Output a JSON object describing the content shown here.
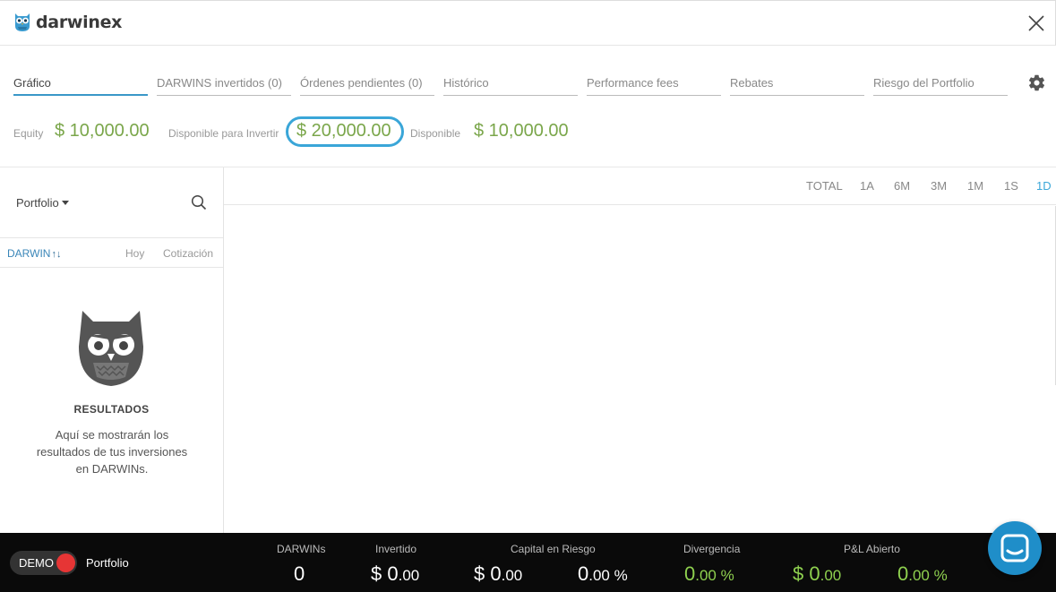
{
  "header": {
    "brand": "darwinex"
  },
  "tabs": [
    {
      "label": "Gráfico",
      "active": true
    },
    {
      "label": "DARWINS invertidos (0)"
    },
    {
      "label": "Órdenes pendientes (0)"
    },
    {
      "label": "Histórico"
    },
    {
      "label": "Performance fees"
    },
    {
      "label": "Rebates"
    },
    {
      "label": "Riesgo del Portfolio"
    }
  ],
  "balances": {
    "equity_label": "Equity",
    "equity_value": "$ 10,000.00",
    "invest_label": "Disponible para Invertir",
    "invest_value": "$ 20,000.00",
    "available_label": "Disponible",
    "available_value": "$ 10,000.00"
  },
  "left": {
    "portfolio_label": "Portfolio",
    "col_darwin": "DARWIN",
    "col_hoy": "Hoy",
    "col_cotizacion": "Cotización",
    "empty_title": "RESULTADOS",
    "empty_desc": "Aquí se mostrarán los resultados de tus inversiones en DARWINs."
  },
  "ranges": [
    "TOTAL",
    "1A",
    "6M",
    "3M",
    "1M",
    "1S",
    "1D"
  ],
  "active_range": "1D",
  "footer": {
    "demo_label": "DEMO",
    "portfolio_label": "Portfolio",
    "darwins_label": "DARWINs",
    "darwins_value": "0",
    "invertido_label": "Invertido",
    "invertido_main": "$ 0",
    "invertido_dec": ".00",
    "capital_label": "Capital en Riesgo",
    "capital_main": "$ 0",
    "capital_dec": ".00",
    "capital_pct_main": "0",
    "capital_pct_dec": ".00 %",
    "divergencia_label": "Divergencia",
    "divergencia_main": "0",
    "divergencia_dec": ".00 %",
    "pl_label": "P&L Abierto",
    "pl_main": "$ 0",
    "pl_dec": ".00",
    "pl_pct_main": "0",
    "pl_pct_dec": ".00 %"
  },
  "colors": {
    "accent": "#3aa6d8",
    "positive": "#7aa64a",
    "footer_positive": "#8fd14f",
    "demo_knob": "#e63535"
  },
  "icons": [
    "owl-logo-icon",
    "close-icon",
    "gear-icon",
    "search-icon",
    "sort-icon",
    "owl-empty-icon",
    "chat-icon"
  ]
}
